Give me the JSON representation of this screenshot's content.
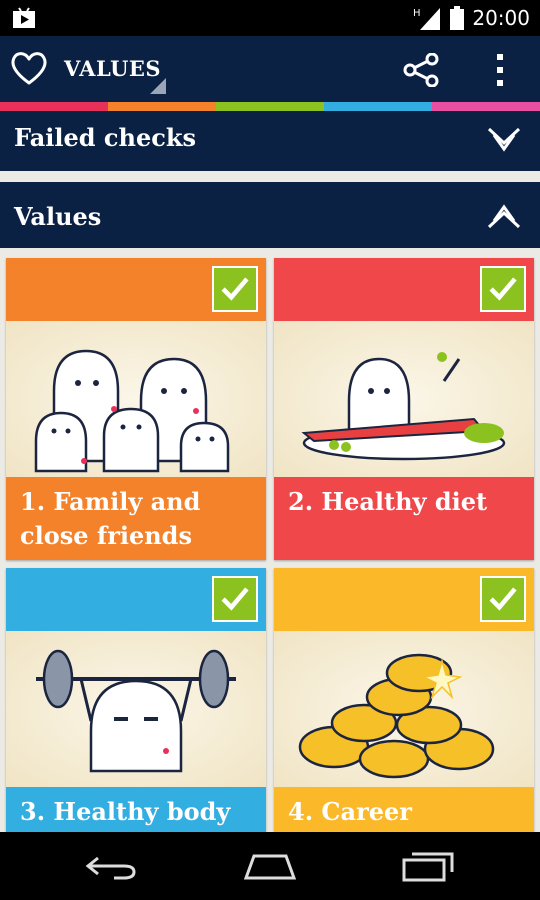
{
  "status_bar": {
    "time": "20:00",
    "network": "H",
    "icons": [
      "play-store-icon",
      "signal-icon",
      "battery-icon"
    ]
  },
  "app_bar": {
    "title": "VALUES",
    "icons": [
      "heart-icon",
      "share-icon",
      "overflow-menu-icon"
    ]
  },
  "color_strip": [
    "#e8315a",
    "#f4822a",
    "#8cc21f",
    "#33aee0",
    "#e84fa0"
  ],
  "sections": {
    "failed_checks": "Failed checks",
    "values": "Values"
  },
  "cards": [
    {
      "label": "1. Family and close friends",
      "color": "#f4822a",
      "checked": true,
      "icon": "family-icon"
    },
    {
      "label": "2. Healthy diet",
      "color": "#f0474a",
      "checked": true,
      "icon": "healthy-diet-icon"
    },
    {
      "label": "3. Healthy body",
      "color": "#33aee0",
      "checked": true,
      "icon": "weightlifting-icon"
    },
    {
      "label": "4. Career",
      "color": "#fbb829",
      "checked": true,
      "icon": "coins-icon"
    }
  ],
  "nav_bar": {
    "icons": [
      "back-icon",
      "home-icon",
      "recent-apps-icon"
    ]
  }
}
